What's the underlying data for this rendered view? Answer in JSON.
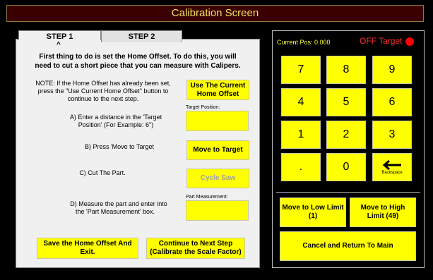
{
  "window": {
    "title": "Calibration Screen"
  },
  "tabs": [
    {
      "label": "STEP 1"
    },
    {
      "label": "STEP 2"
    }
  ],
  "step1": {
    "caret": "^",
    "intro_line1": "First thing to do is set the Home Offset.  To do this, you will",
    "intro_line2": "need to cut a short piece that you can measure with Calipers.",
    "note_line1": "NOTE: If the Home Offset has already been set,",
    "note_line2": "press the \"Use Current Home Offset\" button to",
    "note_line3": "continue to the next step.",
    "use_current_line1": "Use The Current",
    "use_current_line2": "Home Offset",
    "stepA_line1": "A) Enter a distance in the 'Target",
    "stepA_line2": "Position'  (For Example: 6\")",
    "target_position_label": "Target Position:",
    "target_position_value": "",
    "stepB": "B) Press 'Move to Target",
    "move_to_target": "Move to Target",
    "stepC": "C) Cut The Part.",
    "cycle_saw": "Cycle Saw",
    "stepD_line1": "D) Measure the part and enter into",
    "stepD_line2": "the 'Part Measurement' box.",
    "part_measurement_label": "Part Measurement:",
    "part_measurement_value": "",
    "save_line1": "Save the Home Offset And",
    "save_line2": "Exit.",
    "continue_line1": "Continue to Next Step",
    "continue_line2": "(Calibrate the Scale Factor)"
  },
  "status": {
    "current_pos": "Current Pos: 0.000",
    "target_status": "OFF Target",
    "target_status_color": "#ff0000"
  },
  "keypad": {
    "keys": [
      "7",
      "8",
      "9",
      "4",
      "5",
      "6",
      "1",
      "2",
      "3",
      ".",
      "0"
    ],
    "backspace_label": "Backspace"
  },
  "actions": {
    "low_limit_line1": "Move to Low Limit",
    "low_limit_line2": "(1)",
    "high_limit_line1": "Move to High",
    "high_limit_line2": "Limit (49)",
    "cancel": "Cancel and Return To Main"
  }
}
